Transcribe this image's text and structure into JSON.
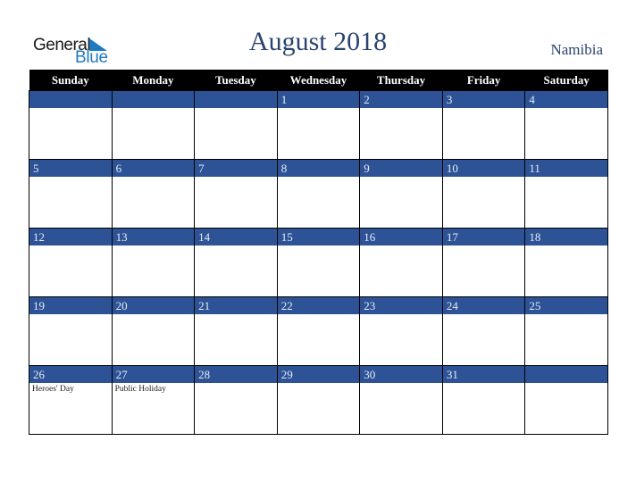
{
  "logo": {
    "line1": "General",
    "line2": "Blue"
  },
  "title": "August 2018",
  "country": "Namibia",
  "colors": {
    "band": "#2d5396",
    "header": "#000000",
    "title": "#2a4470",
    "logo_blue": "#1f7ac0"
  },
  "weekdays": [
    "Sunday",
    "Monday",
    "Tuesday",
    "Wednesday",
    "Thursday",
    "Friday",
    "Saturday"
  ],
  "weeks": [
    [
      {
        "day": "",
        "note": ""
      },
      {
        "day": "",
        "note": ""
      },
      {
        "day": "",
        "note": ""
      },
      {
        "day": "1",
        "note": ""
      },
      {
        "day": "2",
        "note": ""
      },
      {
        "day": "3",
        "note": ""
      },
      {
        "day": "4",
        "note": ""
      }
    ],
    [
      {
        "day": "5",
        "note": ""
      },
      {
        "day": "6",
        "note": ""
      },
      {
        "day": "7",
        "note": ""
      },
      {
        "day": "8",
        "note": ""
      },
      {
        "day": "9",
        "note": ""
      },
      {
        "day": "10",
        "note": ""
      },
      {
        "day": "11",
        "note": ""
      }
    ],
    [
      {
        "day": "12",
        "note": ""
      },
      {
        "day": "13",
        "note": ""
      },
      {
        "day": "14",
        "note": ""
      },
      {
        "day": "15",
        "note": ""
      },
      {
        "day": "16",
        "note": ""
      },
      {
        "day": "17",
        "note": ""
      },
      {
        "day": "18",
        "note": ""
      }
    ],
    [
      {
        "day": "19",
        "note": ""
      },
      {
        "day": "20",
        "note": ""
      },
      {
        "day": "21",
        "note": ""
      },
      {
        "day": "22",
        "note": ""
      },
      {
        "day": "23",
        "note": ""
      },
      {
        "day": "24",
        "note": ""
      },
      {
        "day": "25",
        "note": ""
      }
    ],
    [
      {
        "day": "26",
        "note": "Heroes' Day"
      },
      {
        "day": "27",
        "note": "Public Holiday"
      },
      {
        "day": "28",
        "note": ""
      },
      {
        "day": "29",
        "note": ""
      },
      {
        "day": "30",
        "note": ""
      },
      {
        "day": "31",
        "note": ""
      },
      {
        "day": "",
        "note": ""
      }
    ]
  ]
}
